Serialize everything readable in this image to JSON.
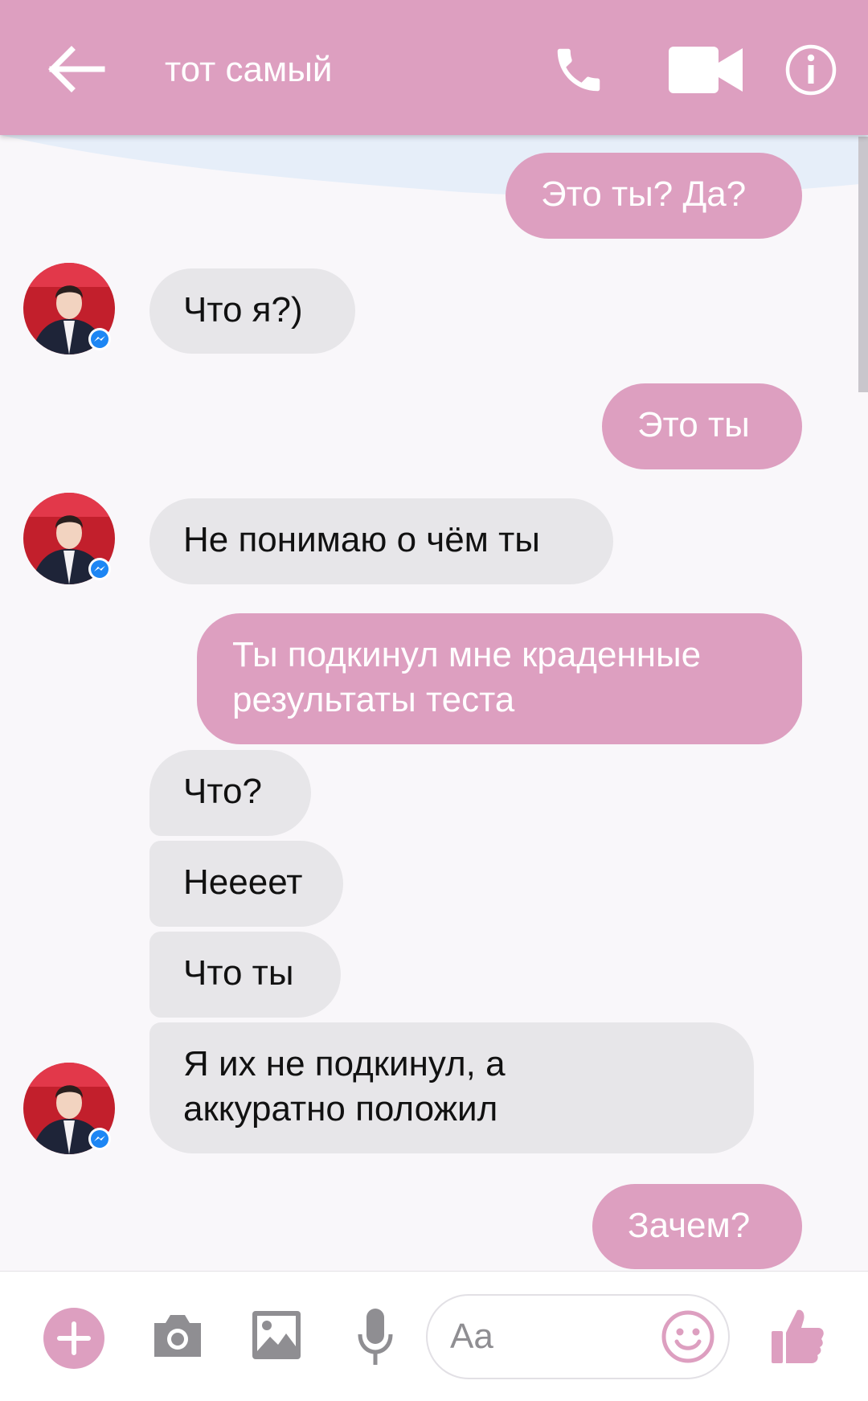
{
  "header": {
    "title": "тот самый",
    "back_icon": "arrow-back-icon",
    "call_icon": "phone-icon",
    "video_icon": "video-camera-icon",
    "info_icon": "info-icon"
  },
  "messages": [
    {
      "direction": "outgoing",
      "text": "Это ты? Да?"
    },
    {
      "direction": "incoming",
      "text": "Что я?)"
    },
    {
      "direction": "outgoing",
      "text": "Это ты"
    },
    {
      "direction": "incoming",
      "text": "Не понимаю о чём ты"
    },
    {
      "direction": "outgoing",
      "lines": [
        "Ты подкинул мне краденные",
        "результаты теста"
      ]
    },
    {
      "direction": "incoming",
      "text": "Что?"
    },
    {
      "direction": "incoming",
      "text": "Нееeет"
    },
    {
      "direction": "incoming",
      "text": "Что ты"
    },
    {
      "direction": "incoming",
      "lines": [
        "Я их не подкинул, а",
        "аккуратно положил"
      ]
    },
    {
      "direction": "outgoing",
      "text": "Зачем?"
    }
  ],
  "composer": {
    "placeholder": "Aa",
    "plus_icon": "plus-icon",
    "camera_icon": "camera-icon",
    "gallery_icon": "image-icon",
    "mic_icon": "microphone-icon",
    "emoji_icon": "smiley-icon",
    "like_icon": "thumbs-up-icon"
  },
  "colors": {
    "accent": "#dd9fc0",
    "incoming_bubble": "#e7e6e9",
    "background": "#f9f7fa"
  }
}
